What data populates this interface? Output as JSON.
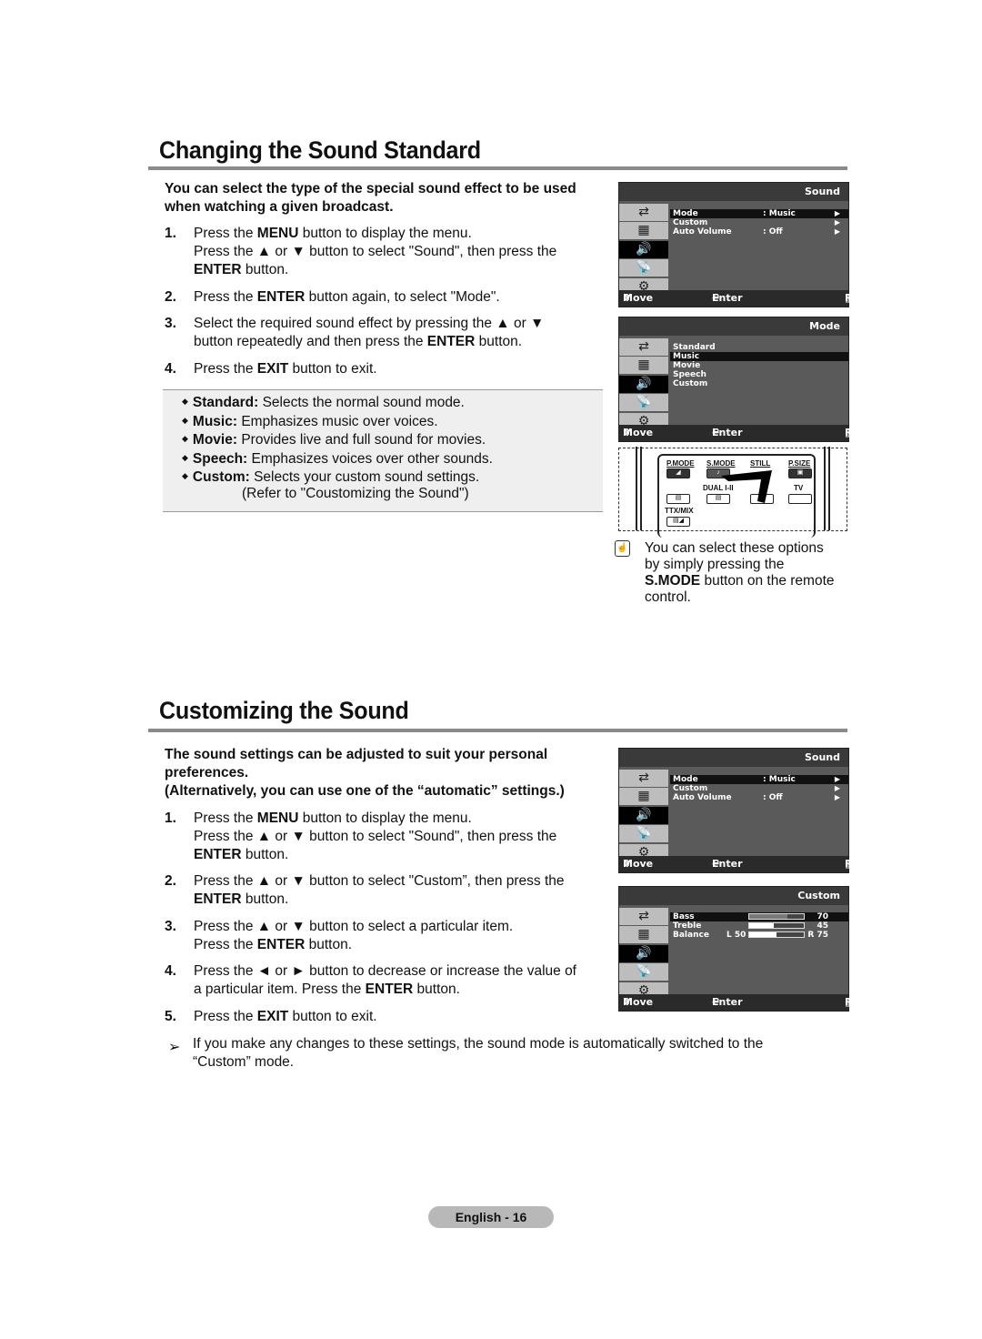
{
  "section1": {
    "title": "Changing the Sound Standard",
    "intro": "You can select the type of the special sound effect to be used when watching a given broadcast.",
    "intro_lines": [
      "You can select the type of the special sound effect to be used",
      "when watching a given broadcast."
    ],
    "steps": [
      {
        "num": "1.",
        "lines": [
          {
            "pre": "Press the ",
            "bold": "MENU",
            "post": " button to display the menu."
          },
          {
            "pre": "Press the ▲ or ▼ button to select \"Sound\", then press the",
            "bold": "",
            "post": ""
          },
          {
            "pre": "",
            "bold": "ENTER",
            "post": " button."
          }
        ]
      },
      {
        "num": "2.",
        "lines": [
          {
            "pre": "Press the ",
            "bold": "ENTER",
            "post": " button again, to select \"Mode\"."
          }
        ]
      },
      {
        "num": "3.",
        "lines": [
          {
            "pre": "Select the required sound effect by pressing the ▲ or ▼",
            "bold": "",
            "post": ""
          },
          {
            "pre": "button repeatedly and then press the ",
            "bold": "ENTER",
            "post": " button."
          }
        ]
      },
      {
        "num": "4.",
        "lines": [
          {
            "pre": "Press the ",
            "bold": "EXIT",
            "post": " button to exit."
          }
        ]
      }
    ],
    "notes": [
      {
        "term": "Standard:",
        "desc": " Selects the normal sound mode."
      },
      {
        "term": "Music:",
        "desc": " Emphasizes music over voices."
      },
      {
        "term": "Movie:",
        "desc": " Provides live and full sound for movies."
      },
      {
        "term": "Speech:",
        "desc": " Emphasizes voices over other sounds."
      },
      {
        "term": "Custom:",
        "desc": " Selects your custom sound settings."
      }
    ],
    "notes_extra": "(Refer to \"Coustomizing the Sound\")",
    "tip_lines": [
      "You can select these options",
      "by simply pressing the"
    ],
    "tip_bold": "S.MODE",
    "tip_after": " button on the remote",
    "tip_last": "control."
  },
  "osd_common": {
    "move": "Move",
    "enter": "Enter",
    "return": "Return",
    "side_icons": [
      "input-icon",
      "picture-icon",
      "sound-icon",
      "channel-icon",
      "setup-icon"
    ]
  },
  "osd_sound": {
    "title": "Sound",
    "items": [
      {
        "label": "Mode",
        "value": ": Music",
        "arrow": "▶"
      },
      {
        "label": "Custom",
        "value": "",
        "arrow": "▶"
      },
      {
        "label": "Auto Volume",
        "value": ": Off",
        "arrow": "▶"
      }
    ]
  },
  "osd_mode": {
    "title": "Mode",
    "items": [
      "Standard",
      "Music",
      "Movie",
      "Speech",
      "Custom"
    ],
    "selected": "Music"
  },
  "osd_custom": {
    "title": "Custom",
    "items": [
      {
        "label": "Bass",
        "left": "",
        "value_text": "70",
        "level": 70
      },
      {
        "label": "Treble",
        "left": "",
        "value_text": "45",
        "level": 45
      },
      {
        "label": "Balance",
        "left": "L 50",
        "value_text": "R 75",
        "level": 50
      }
    ]
  },
  "remote": {
    "top_labels": [
      "P.MODE",
      "S.MODE",
      "STILL",
      "P.SIZE"
    ],
    "mid_labels": [
      "DUAL I-II",
      "TV"
    ],
    "bottom_label": "TTX/MIX"
  },
  "section2": {
    "title": "Customizing the Sound",
    "intro_lines": [
      "The sound settings can be adjusted to suit your personal",
      "preferences.",
      "(Alternatively, you can use one of the “automatic” settings.)"
    ],
    "steps": [
      {
        "num": "1.",
        "lines": [
          {
            "pre": "Press the ",
            "bold": "MENU",
            "post": " button to display the menu."
          },
          {
            "pre": "Press the ▲ or ▼ button to select \"Sound\", then press the",
            "bold": "",
            "post": ""
          },
          {
            "pre": "",
            "bold": "ENTER",
            "post": " button."
          }
        ]
      },
      {
        "num": "2.",
        "lines": [
          {
            "pre": "Press the ▲ or ▼ button to select \"Custom”, then press the",
            "bold": "",
            "post": ""
          },
          {
            "pre": "",
            "bold": "ENTER",
            "post": " button."
          }
        ]
      },
      {
        "num": "3.",
        "lines": [
          {
            "pre": "Press the ▲ or ▼ button to select a particular item.",
            "bold": "",
            "post": ""
          },
          {
            "pre": "Press the ",
            "bold": "ENTER",
            "post": " button."
          }
        ]
      },
      {
        "num": "4.",
        "lines": [
          {
            "pre": "Press the ◄ or ► button to decrease or increase the value of",
            "bold": "",
            "post": ""
          },
          {
            "pre": "a particular item. Press the ",
            "bold": "ENTER",
            "post": " button."
          }
        ]
      },
      {
        "num": "5.",
        "lines": [
          {
            "pre": "Press the ",
            "bold": "EXIT",
            "post": " button to exit."
          }
        ]
      }
    ],
    "note_lines": [
      "If you make any changes to these settings, the sound mode is automatically switched to the",
      "“Custom” mode."
    ]
  },
  "footer": {
    "page_label": "English - 16"
  }
}
